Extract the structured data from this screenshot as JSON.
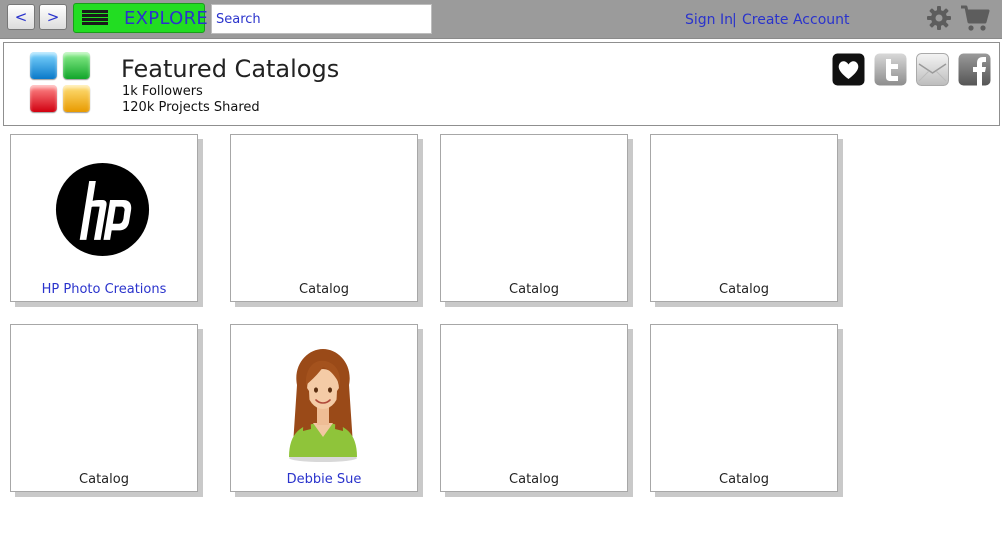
{
  "topbar": {
    "back_label": "<",
    "forward_label": ">",
    "explore_label": "EXPLORE",
    "search": {
      "placeholder": "Search",
      "value": ""
    },
    "sign_in": "Sign In",
    "separator": "|",
    "create_account": "Create Account"
  },
  "header": {
    "title": "Featured Catalogs",
    "followers": "1k Followers",
    "projects": "120k Projects Shared"
  },
  "catalogs": [
    {
      "label": "HP Photo Creations",
      "link": true,
      "image": "hp-logo"
    },
    {
      "label": "Catalog",
      "link": false
    },
    {
      "label": "Catalog",
      "link": false
    },
    {
      "label": "Catalog",
      "link": false
    },
    {
      "label": "Catalog",
      "link": false
    },
    {
      "label": "Debbie Sue",
      "link": true,
      "image": "avatar"
    },
    {
      "label": "Catalog",
      "link": false
    },
    {
      "label": "Catalog",
      "link": false
    }
  ],
  "colors": {
    "link": "#2a33cc",
    "explore_bg": "#22dd22",
    "topbar_bg": "#9b9b9b"
  },
  "icons": [
    "menu-icon",
    "gear-icon",
    "cart-icon",
    "heart-icon",
    "twitter-icon",
    "email-icon",
    "facebook-icon"
  ]
}
